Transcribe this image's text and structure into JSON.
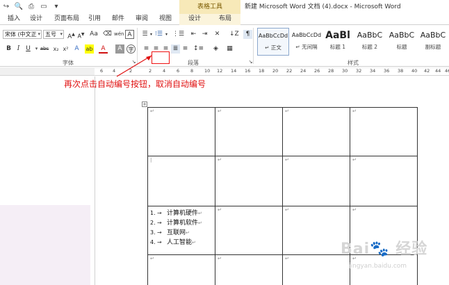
{
  "window": {
    "title": "新建 Microsoft Word 文档 (4).docx - Microsoft Word",
    "context_group": "表格工具"
  },
  "tabs": [
    "插入",
    "设计",
    "页面布局",
    "引用",
    "邮件",
    "审阅",
    "视图",
    "设计",
    "布局"
  ],
  "ribbon": {
    "font": {
      "name": "宋体 (中文正",
      "size": "五号",
      "group_label": "字体",
      "grow": "A",
      "shrink": "A",
      "case": "Aa",
      "phonetic": "wén",
      "border_char": "A",
      "bold": "B",
      "italic": "I",
      "underline": "U",
      "strike": "abc",
      "subscript": "x₂",
      "superscript": "x²",
      "text_effects": "A",
      "highlight": "ab",
      "font_color": "A",
      "shading": "A",
      "enclose": "字"
    },
    "paragraph": {
      "group_label": "段落"
    },
    "styles": {
      "group_label": "样式",
      "items": [
        {
          "sample": "AaBbCcDd",
          "name": "↵ 正文"
        },
        {
          "sample": "AaBbCcDd",
          "name": "↵ 无间隔"
        },
        {
          "sample": "AaBl",
          "name": "标题 1"
        },
        {
          "sample": "AaBbC",
          "name": "标题 2"
        },
        {
          "sample": "AaBbC",
          "name": "标题"
        },
        {
          "sample": "AaBbC",
          "name": "副标题"
        }
      ]
    }
  },
  "ruler": {
    "numbers": [
      "6",
      "4",
      "2",
      "2",
      "4",
      "6",
      "8",
      "10",
      "12",
      "14",
      "16",
      "18",
      "20",
      "22",
      "24",
      "26",
      "28",
      "30",
      "32",
      "34",
      "36",
      "38",
      "40",
      "42",
      "44",
      "46"
    ]
  },
  "annotation": "再次点击自动编号按钮，取消自动编号",
  "document": {
    "paragraph_mark": "↵",
    "table_handle": "+",
    "list_items": [
      {
        "num": "1.",
        "text": "计算机硬件"
      },
      {
        "num": "2.",
        "text": "计算机软件"
      },
      {
        "num": "3.",
        "text": "互联网"
      },
      {
        "num": "4.",
        "text": "人工智能"
      }
    ]
  },
  "watermark": {
    "main": "Bai🐾 经验",
    "sub": "jingyan.baidu.com"
  }
}
